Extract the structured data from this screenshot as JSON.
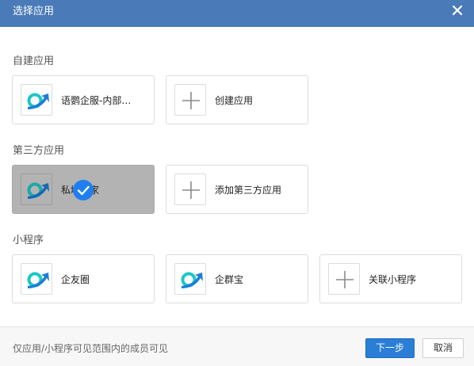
{
  "dialog": {
    "title": "选择应用",
    "close_icon": "close-icon"
  },
  "sections": {
    "self_built": {
      "label": "自建应用",
      "items": [
        {
          "label": "语鹦企服-内部…",
          "icon": "app-logo-icon"
        },
        {
          "label": "创建应用",
          "icon": "plus-icon"
        }
      ]
    },
    "third_party": {
      "label": "第三方应用",
      "items": [
        {
          "label": "私域管家",
          "icon": "app-logo-icon",
          "selected": true
        },
        {
          "label": "添加第三方应用",
          "icon": "plus-icon"
        }
      ]
    },
    "mini_program": {
      "label": "小程序",
      "items": [
        {
          "label": "企友圈",
          "icon": "app-logo-icon"
        },
        {
          "label": "企群宝",
          "icon": "app-logo-icon"
        },
        {
          "label": "关联小程序",
          "icon": "plus-icon"
        }
      ]
    }
  },
  "footer": {
    "note": "仅应用/小程序可见范围内的成员可见",
    "next_label": "下一步",
    "cancel_label": "取消"
  },
  "colors": {
    "titlebar": "#4a7ab8",
    "primary": "#2a7ed6",
    "selected_card": "#b3b3b3",
    "check": "#1f7ff0",
    "logo_teal": "#1cc7c7",
    "logo_blue": "#1a7fd8"
  }
}
